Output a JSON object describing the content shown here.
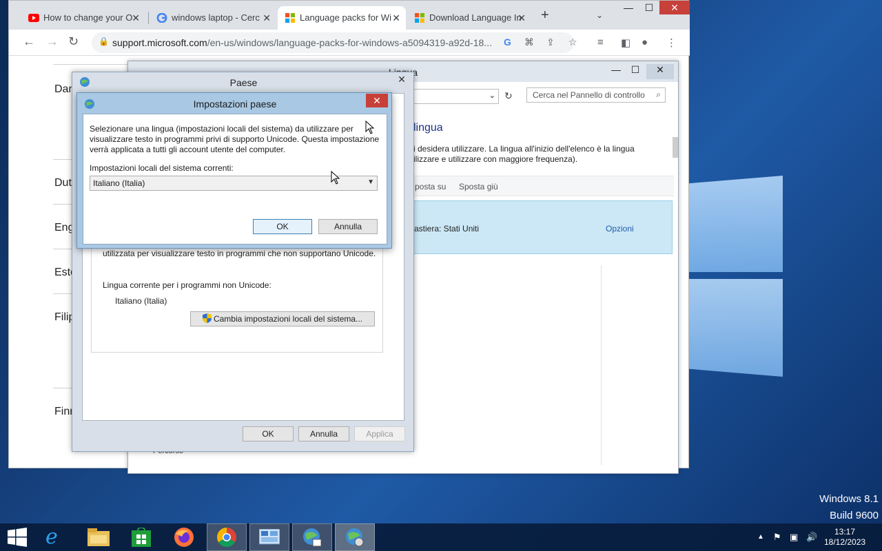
{
  "desktop": {
    "watermark_line1": "Windows 8.1",
    "watermark_line2": "Build 9600"
  },
  "browser": {
    "tabs": [
      {
        "label": "How to change your O",
        "favicon": "youtube-icon",
        "active": false
      },
      {
        "label": "windows laptop - Cerc",
        "favicon": "google-icon",
        "active": false
      },
      {
        "label": "Language packs for Wi",
        "favicon": "microsoft-icon",
        "active": true
      },
      {
        "label": "Download Language In",
        "favicon": "microsoft-icon",
        "active": false
      }
    ],
    "url_domain": "support.microsoft.com",
    "url_path": "/en-us/windows/language-packs-for-windows-a5094319-a92d-18...",
    "side_items": [
      "Dan",
      "Dut",
      "Eng",
      "Esto",
      "Filip",
      "Finn"
    ],
    "colors": {
      "tabstrip": "#dee1e6",
      "accent": "#1a73e8"
    }
  },
  "lingua": {
    "title": "Lingua",
    "search_placeholder": "Cerca nel Pannello di controllo",
    "heading": "lingua",
    "desc_line1": "i desidera utilizzare. La lingua all'inizio dell'elenco è la lingua",
    "desc_line2": "ilizzare e utilizzare con maggiore frequenza).",
    "cmd_up": "posta su",
    "cmd_down": "Sposta giù",
    "row_keyboard": "astiera: Stati Uniti",
    "row_options": "Opzioni",
    "percorso": "Percorso"
  },
  "paese": {
    "title": "Paese",
    "partial_text": "utilizzata per visualizzare testo in programmi che non supportano Unicode.",
    "current_label": "Lingua corrente per i programmi non Unicode:",
    "current_value": "Italiano (Italia)",
    "change_button": "Cambia impostazioni locali del sistema...",
    "ok": "OK",
    "cancel": "Annulla",
    "apply": "Applica"
  },
  "impostazioni": {
    "title": "Impostazioni paese",
    "paragraph_line1": "Selezionare una lingua (impostazioni locali del sistema) da utilizzare per",
    "paragraph_line2": "visualizzare testo in programmi privi di supporto Unicode. Questa impostazione",
    "paragraph_line3": "verrà applicata a tutti gli account utente del computer.",
    "select_label": "Impostazioni locali del sistema correnti:",
    "select_value": "Italiano (Italia)",
    "ok": "OK",
    "cancel": "Annulla",
    "close_color": "#c7403a"
  },
  "taskbar": {
    "apps": [
      "start-icon",
      "internet-explorer-icon",
      "file-explorer-icon",
      "store-icon",
      "firefox-icon",
      "chrome-icon",
      "control-panel-icon",
      "region-icon",
      "region-settings-icon"
    ],
    "time": "13:17",
    "date": "18/12/2023"
  }
}
